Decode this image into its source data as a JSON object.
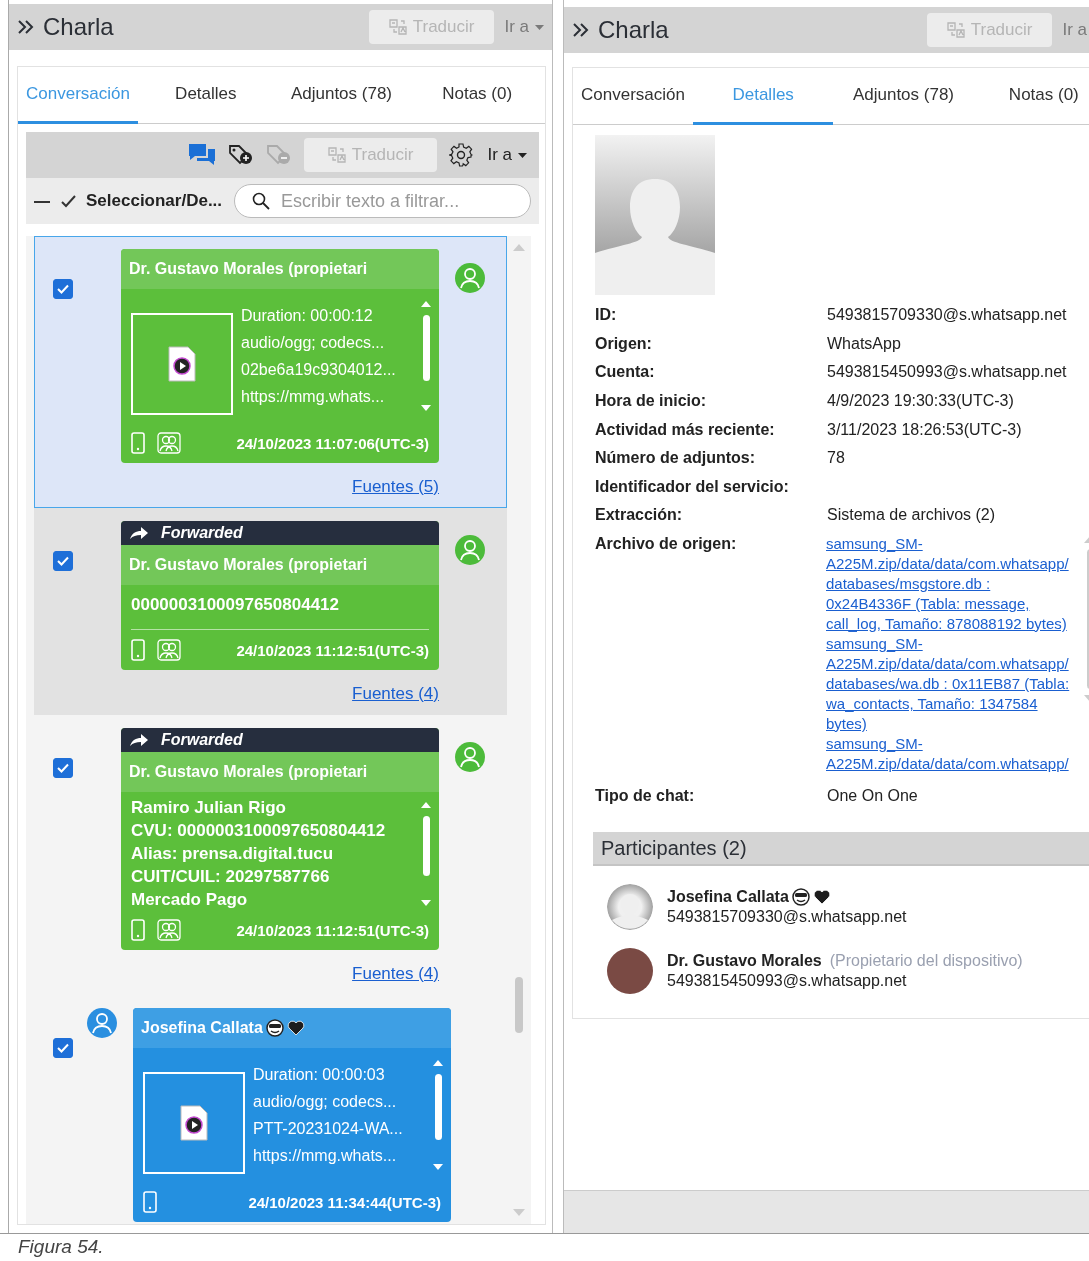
{
  "left_panel": {
    "title": "Charla",
    "translate_button": {
      "label": "Traducir",
      "disabled": true
    },
    "goto_menu": {
      "label": "Ir a",
      "disabled": true
    },
    "tabs": [
      {
        "label": "Conversación",
        "selected": true
      },
      {
        "label": "Detalles",
        "selected": false
      },
      {
        "label": "Adjuntos (78)",
        "selected": false
      },
      {
        "label": "Notas (0)",
        "selected": false
      }
    ],
    "toolbar": {
      "translate_button": {
        "label": "Traducir",
        "disabled": true
      },
      "goto_menu": {
        "label": "Ir a",
        "disabled": false
      }
    },
    "select_toggle": "Seleccionar/De...",
    "filter": {
      "placeholder": "Escribir texto a filtrar..."
    },
    "messages": [
      {
        "kind": "outgoing",
        "checked": true,
        "selected": true,
        "hovered": false,
        "sender": "Dr. Gustavo Morales (propietari",
        "name_emoji": false,
        "body": {
          "kind": "attachment",
          "lines": [
            "Duration: 00:00:12",
            "audio/ogg; codecs...",
            "02be6a19c9304012...",
            "https://mmg.whats..."
          ]
        },
        "group_icon": true,
        "timestamp": "24/10/2023 11:07:06(UTC-3)",
        "sources": "Fuentes (5)"
      },
      {
        "kind": "outgoing",
        "checked": true,
        "selected": false,
        "hovered": true,
        "forwarded_banner": "Forwarded",
        "sender": "Dr. Gustavo Morales (propietari",
        "name_emoji": false,
        "body": {
          "kind": "text",
          "lines": [
            "0000003100097650804412"
          ]
        },
        "group_icon": true,
        "timestamp": "24/10/2023 11:12:51(UTC-3)",
        "sources": "Fuentes (4)"
      },
      {
        "kind": "outgoing",
        "checked": true,
        "selected": false,
        "hovered": false,
        "forwarded_banner": "Forwarded",
        "sender": "Dr. Gustavo Morales (propietari",
        "name_emoji": false,
        "body": {
          "kind": "text",
          "lines": [
            "Ramiro Julian Rigo",
            "CVU: 0000003100097650804412",
            "Alias: prensa.digital.tucu",
            "CUIT/CUIL: 20297587766",
            "Mercado Pago"
          ]
        },
        "group_icon": true,
        "timestamp": "24/10/2023 11:12:51(UTC-3)",
        "sources": "Fuentes (4)"
      },
      {
        "kind": "incoming",
        "checked": true,
        "selected": false,
        "hovered": false,
        "sender": "Josefina Callata",
        "name_emoji": true,
        "body": {
          "kind": "attachment",
          "lines": [
            "Duration: 00:00:03",
            "audio/ogg; codecs...",
            "PTT-20231024-WA...",
            "https://mmg.whats..."
          ]
        },
        "group_icon": false,
        "timestamp": "24/10/2023 11:34:44(UTC-3)"
      }
    ]
  },
  "right_panel": {
    "title": "Charla",
    "translate_button": {
      "label": "Traducir",
      "disabled": true
    },
    "goto_menu": {
      "label": "Ir a",
      "disabled": true
    },
    "tabs": [
      {
        "label": "Conversación",
        "selected": false
      },
      {
        "label": "Detalles",
        "selected": true
      },
      {
        "label": "Adjuntos (78)",
        "selected": false
      },
      {
        "label": "Notas (0)",
        "selected": false
      }
    ],
    "details": [
      {
        "label": "ID:",
        "value": "5493815709330@s.whatsapp.net"
      },
      {
        "label": "Origen:",
        "value": "WhatsApp"
      },
      {
        "label": "Cuenta:",
        "value": "5493815450993@s.whatsapp.net"
      },
      {
        "label": "Hora de inicio:",
        "value": "4/9/2023 19:30:33(UTC-3)"
      },
      {
        "label": "Actividad más reciente:",
        "value": "3/11/2023 18:26:53(UTC-3)"
      },
      {
        "label": "Número de adjuntos:",
        "value": "78"
      },
      {
        "label": "Identificador del servicio:"
      },
      {
        "label": "Extracción:",
        "value": "Sistema de archivos (2)"
      },
      {
        "label": "Archivo de origen:",
        "links": [
          "samsung_SM-A225M.zip/data/data/com.whatsapp/databases/msgstore.db : 0x24B4336F (Tabla: message, call_log, Tamaño: 878088192 bytes)",
          "samsung_SM-A225M.zip/data/data/com.whatsapp/databases/wa.db : 0x11EB87 (Tabla: wa_contacts, Tamaño: 1347584 bytes)",
          "samsung_SM-A225M.zip/data/data/com.whatsapp/"
        ]
      },
      {
        "label": "Tipo de chat:",
        "value": "One On One"
      }
    ],
    "participants_header": "Participantes (2)",
    "participants": [
      {
        "name": "Josefina Callata",
        "name_emoji": true,
        "id": "5493815709330@s.whatsapp.net",
        "photo": false
      },
      {
        "name": "Dr. Gustavo Morales",
        "role": "(Propietario del dispositivo)",
        "name_emoji": false,
        "id": "5493815450993@s.whatsapp.net",
        "photo": true
      }
    ]
  },
  "caption": "Figura 54."
}
